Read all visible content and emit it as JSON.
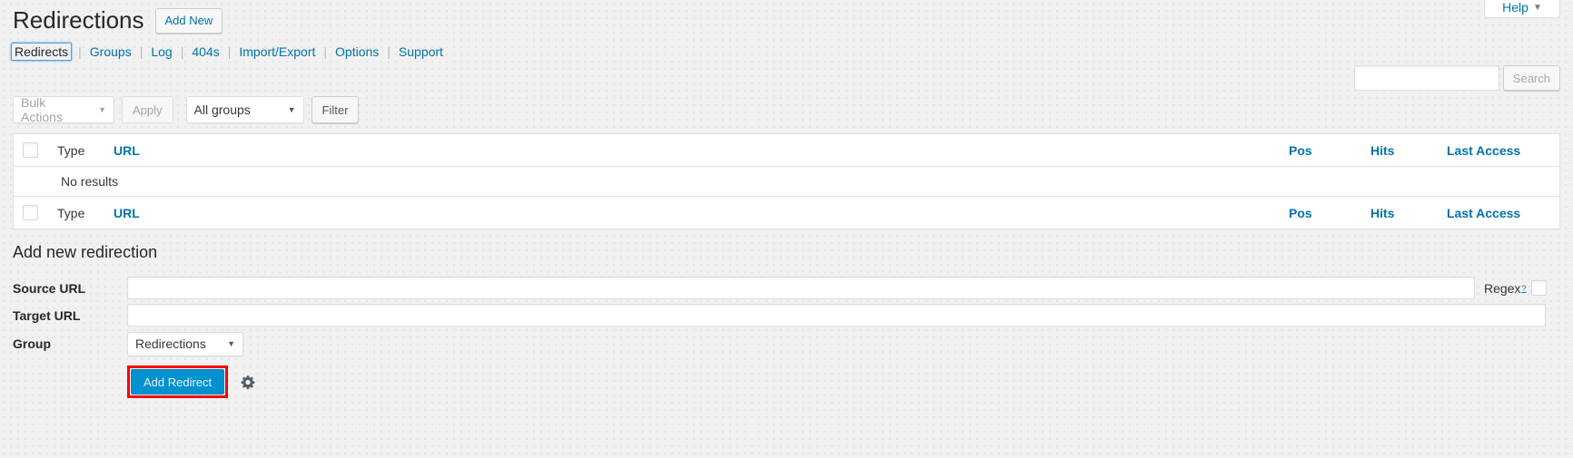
{
  "help_tab": {
    "label": "Help",
    "caret": "chevron-down-icon"
  },
  "header": {
    "title": "Redirections",
    "add_new_label": "Add New"
  },
  "subnav": {
    "separator": "|",
    "items": [
      {
        "label": "Redirects",
        "current": true
      },
      {
        "label": "Groups",
        "current": false
      },
      {
        "label": "Log",
        "current": false
      },
      {
        "label": "404s",
        "current": false
      },
      {
        "label": "Import/Export",
        "current": false
      },
      {
        "label": "Options",
        "current": false
      },
      {
        "label": "Support",
        "current": false
      }
    ]
  },
  "search": {
    "value": "",
    "placeholder": "",
    "button_label": "Search"
  },
  "tablenav": {
    "bulk_actions_label": "Bulk Actions",
    "apply_label": "Apply",
    "group_filter_label": "All groups",
    "filter_label": "Filter"
  },
  "table": {
    "columns": {
      "type": "Type",
      "url": "URL",
      "pos": "Pos",
      "hits": "Hits",
      "last_access": "Last Access"
    },
    "empty_message": "No results",
    "rows": []
  },
  "add_form": {
    "section_title": "Add new redirection",
    "source_label": "Source URL",
    "source_value": "",
    "source_placeholder": "",
    "regex_label": "Regex",
    "regex_help": "?",
    "regex_checked": false,
    "target_label": "Target URL",
    "target_value": "",
    "target_placeholder": "",
    "group_label": "Group",
    "group_value": "Redirections",
    "submit_label": "Add Redirect",
    "gear_icon": "gear-icon"
  },
  "colors": {
    "link": "#0073aa",
    "primary_button": "#0091d0",
    "highlight": "#ff0000",
    "page_bg": "#f1f1f1"
  }
}
